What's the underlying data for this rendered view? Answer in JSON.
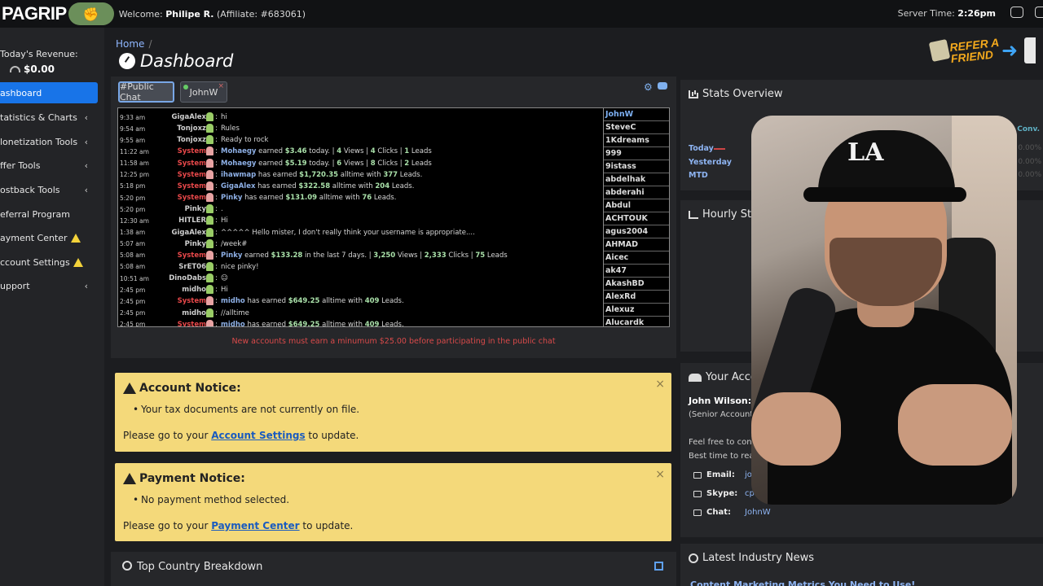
{
  "brand": {
    "logo_text": "PAGRIP",
    "logo_mark": "fist-icon"
  },
  "header": {
    "welcome_prefix": "Welcome:",
    "user_name": "Philipe R.",
    "affiliate": "(Affiliate: #683061)",
    "server_time_label": "Server Time:",
    "server_time": "2:26pm"
  },
  "sidebar": {
    "revenue_label": "Today's Revenue:",
    "revenue_value": "$0.00",
    "items": [
      {
        "label": "ashboard",
        "active": true
      },
      {
        "label": "tatistics & Charts",
        "chevron": "‹"
      },
      {
        "label": "lonetization Tools",
        "chevron": "‹"
      },
      {
        "label": "ffer Tools",
        "chevron": "‹"
      },
      {
        "label": "ostback Tools",
        "chevron": "‹"
      },
      {
        "label": "eferral Program"
      },
      {
        "label": "ayment Center",
        "warning": true
      },
      {
        "label": "ccount Settings",
        "warning": true
      },
      {
        "label": "upport",
        "chevron": "‹"
      }
    ]
  },
  "breadcrumb": {
    "home": "Home",
    "sep": "/"
  },
  "page_title": "Dashboard",
  "refer": {
    "text_line1": "REFER A",
    "text_line2": "FRIEND"
  },
  "chat": {
    "tabs": [
      {
        "label": "#Public Chat"
      },
      {
        "label": "JohnW"
      }
    ],
    "messages": [
      {
        "time": "9:33 am",
        "user": "GigaAlex",
        "text": "hi"
      },
      {
        "time": "9:54 am",
        "user": "Tonjoxz",
        "text": "Rules"
      },
      {
        "time": "9:55 am",
        "user": "Tonjoxz",
        "text": "Ready to rock"
      },
      {
        "time": "11:22 am",
        "user": "System",
        "name": "Mohaegy",
        "a": " earned ",
        "amount": "$3.46",
        "b": " today. | ",
        "n1": "4",
        "c": " Views | ",
        "n2": "4",
        "d": " Clicks | ",
        "n3": "1",
        "e": " Leads"
      },
      {
        "time": "11:58 am",
        "user": "System",
        "name": "Mohaegy",
        "a": " earned ",
        "amount": "$5.19",
        "b": " today. | ",
        "n1": "6",
        "c": " Views | ",
        "n2": "8",
        "d": " Clicks | ",
        "n3": "2",
        "e": " Leads"
      },
      {
        "time": "12:25 pm",
        "user": "System",
        "name": "ihawmap",
        "a": " has earned ",
        "amount": "$1,720.35",
        "b": " alltime with ",
        "n1": "377",
        "c": " Leads.",
        "n2": "",
        "d": "",
        "n3": "",
        "e": ""
      },
      {
        "time": "5:18 pm",
        "user": "System",
        "name": "GigaAlex",
        "a": " has earned ",
        "amount": "$322.58",
        "b": " alltime with ",
        "n1": "204",
        "c": " Leads.",
        "n2": "",
        "d": "",
        "n3": "",
        "e": ""
      },
      {
        "time": "5:20 pm",
        "user": "System",
        "name": "Pinky",
        "a": " has earned ",
        "amount": "$131.09",
        "b": " alltime with ",
        "n1": "76",
        "c": " Leads.",
        "n2": "",
        "d": "",
        "n3": "",
        "e": ""
      },
      {
        "time": "5:20 pm",
        "user": "Pinky",
        "text": "."
      },
      {
        "time": "12:30 am",
        "user": "HITLER",
        "text": "Hi"
      },
      {
        "time": "1:38 am",
        "user": "GigaAlex",
        "text": "^^^^^ Hello mister, I don't really think your username is appropriate...."
      },
      {
        "time": "5:07 am",
        "user": "Pinky",
        "text": "/week#"
      },
      {
        "time": "5:08 am",
        "user": "System",
        "name": "Pinky",
        "a": " earned ",
        "amount": "$133.28",
        "b": " in the last 7 days. | ",
        "n1": "3,250",
        "c": " Views | ",
        "n2": "2,333",
        "d": " Clicks | ",
        "n3": "75",
        "e": " Leads"
      },
      {
        "time": "5:08 am",
        "user": "SrET06",
        "text": "nice pinky!"
      },
      {
        "time": "10:51 am",
        "user": "DinoDabs",
        "text": "☺"
      },
      {
        "time": "2:45 pm",
        "user": "midho",
        "text": "Hi"
      },
      {
        "time": "2:45 pm",
        "user": "System",
        "name": "midho",
        "a": " has earned ",
        "amount": "$649.25",
        "b": " alltime with ",
        "n1": "409",
        "c": " Leads.",
        "n2": "",
        "d": "",
        "n3": "",
        "e": ""
      },
      {
        "time": "2:45 pm",
        "user": "midho",
        "text": "//alltime"
      },
      {
        "time": "2:45 pm",
        "user": "System",
        "name": "midho",
        "a": " has earned ",
        "amount": "$649.25",
        "b": " alltime with ",
        "n1": "409",
        "c": " Leads.",
        "n2": "",
        "d": "",
        "n3": "",
        "e": ""
      }
    ],
    "users": [
      "JohnW",
      "SteveC",
      "1Kdreams",
      "999",
      "9istass",
      "abdelhak",
      "abderahi",
      "Abdul",
      "ACHTOUK",
      "agus2004",
      "AHMAD",
      "Aicec",
      "ak47",
      "AkashBD",
      "AlexRd",
      "Alexuz",
      "Alucardk"
    ],
    "warning": "New accounts must earn a minumum $25.00 before participating in the public chat"
  },
  "notices": [
    {
      "title": "Account Notice:",
      "bullet": "Your tax documents are not currently on file.",
      "pre": "Please go to your ",
      "link": "Account Settings",
      "post": " to update.",
      "close": "×"
    },
    {
      "title": "Payment Notice:",
      "bullet": "No payment method selected.",
      "pre": "Please go to your ",
      "link": "Payment Center",
      "post": " to update.",
      "close": "×"
    }
  ],
  "top_country": {
    "title": "Top Country Breakdown"
  },
  "stats": {
    "title": "Stats Overview",
    "rows": [
      "Today",
      "Yesterday",
      "MTD"
    ],
    "conv_header": "Conv.",
    "conv_values": [
      "0.00%",
      "0.00%",
      "0.00%"
    ]
  },
  "hourly": {
    "title": "Hourly Sta"
  },
  "account_manager": {
    "title": "Your Acco",
    "name": "John Wilson:",
    "role": "(Senior Account",
    "line1": "Feel free to conta",
    "line2": "Best time to reac",
    "email_label": "Email:",
    "email_value": "jo",
    "skype_label": "Skype:",
    "skype_value": "cpag",
    "chat_label": "Chat:",
    "chat_value": "JohnW"
  },
  "news": {
    "title": "Latest Industry News",
    "first_headline": "Content Marketing Metrics You Need to Use!"
  },
  "webcam": {
    "cap_logo": "LA"
  },
  "colors": {
    "accent": "#1874e8",
    "notice": "#f4d97a",
    "system": "#e8484a",
    "link": "#8eb4f2"
  }
}
